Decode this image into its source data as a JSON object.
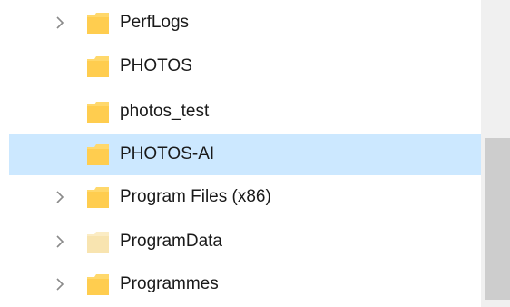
{
  "tree": {
    "items": [
      {
        "label": "PerfLogs",
        "expandable": true,
        "selected": false,
        "icon": "folder-icon"
      },
      {
        "label": "PHOTOS",
        "expandable": false,
        "selected": false,
        "icon": "folder-icon"
      },
      {
        "label": "photos_test",
        "expandable": false,
        "selected": false,
        "icon": "folder-icon"
      },
      {
        "label": "PHOTOS-AI",
        "expandable": false,
        "selected": true,
        "icon": "folder-icon"
      },
      {
        "label": "Program Files (x86)",
        "expandable": true,
        "selected": false,
        "icon": "folder-icon"
      },
      {
        "label": "ProgramData",
        "expandable": true,
        "selected": false,
        "icon": "folder-hidden-icon"
      },
      {
        "label": "Programmes",
        "expandable": true,
        "selected": false,
        "icon": "folder-icon"
      }
    ]
  },
  "colors": {
    "selection_bg": "#cce8ff",
    "folder_fill": "#ffd86b",
    "folder_hidden_fill": "#fbecc4",
    "scrollbar_track": "#f0f0f0",
    "scrollbar_thumb": "#cdcdcd"
  }
}
